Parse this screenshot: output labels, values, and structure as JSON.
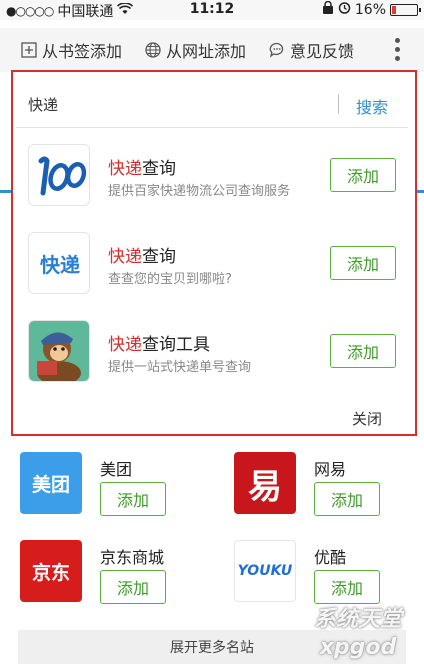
{
  "status_bar": {
    "carrier": "中国联通",
    "time": "11:12",
    "battery": "16%"
  },
  "toolbar": {
    "bookmark_label": "从书签添加",
    "url_label": "从网址添加",
    "feedback_label": "意见反馈"
  },
  "search": {
    "value": "快递",
    "button": "搜索"
  },
  "results": [
    {
      "title_highlight": "快递",
      "title_rest": "查询",
      "desc": "提供百家快递物流公司查询服务",
      "add": "添加",
      "icon": "kuaidi100-logo"
    },
    {
      "title_highlight": "快递",
      "title_rest": "查询",
      "desc": "查查您的宝贝到哪啦?",
      "add": "添加",
      "icon": "kuaidi-text-logo"
    },
    {
      "title_highlight": "快递",
      "title_rest": "查询工具",
      "desc": "提供一站式快递单号查询",
      "add": "添加",
      "icon": "courier-monkey-logo"
    }
  ],
  "close_label": "关闭",
  "sites": [
    {
      "name": "美团",
      "logo_text": "美团",
      "add": "添加",
      "color": "#3c9ee8"
    },
    {
      "name": "网易",
      "logo_text": "易",
      "add": "添加",
      "color": "#c8161d"
    },
    {
      "name": "京东商城",
      "logo_text": "京东",
      "add": "添加",
      "color": "#d71c1c"
    },
    {
      "name": "优酷",
      "logo_text": "YOUKU",
      "add": "添加",
      "color": "#ffffff"
    }
  ],
  "more_sites": "展开更多名站",
  "watermark": {
    "line1": "系统天堂",
    "line2": "xpgod"
  },
  "colors": {
    "highlight_frame": "#d32f2f",
    "accent_blue": "#2f8fd1",
    "add_green": "#5cae3a"
  }
}
